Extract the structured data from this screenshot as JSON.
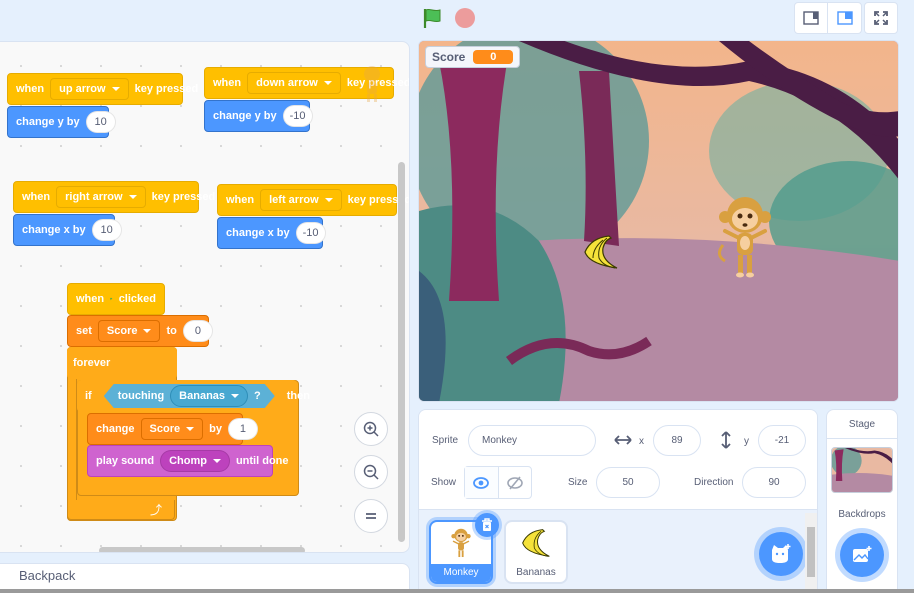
{
  "toolbar": {
    "green_flag_icon": "green-flag-icon",
    "stop_icon": "stop-icon",
    "small_stage_icon": "small-stage-icon",
    "normal_stage_icon": "normal-stage-icon",
    "fullscreen_icon": "fullscreen-icon"
  },
  "scripts": {
    "up": {
      "when": "when",
      "key": "up arrow",
      "pressed": "key pressed",
      "action": "change y by",
      "value": "10"
    },
    "down": {
      "when": "when",
      "key": "down arrow",
      "pressed": "key pressed",
      "action": "change y by",
      "value": "-10"
    },
    "right": {
      "when": "when",
      "key": "right arrow",
      "pressed": "key pressed",
      "action": "change x by",
      "value": "10"
    },
    "left": {
      "when": "when",
      "key": "left arrow",
      "pressed": "key pressed",
      "action": "change x by",
      "value": "-10"
    },
    "main": {
      "when": "when",
      "clicked": "clicked",
      "set": "set",
      "set_var": "Score",
      "to": "to",
      "set_value": "0",
      "forever": "forever",
      "if": "if",
      "touching": "touching",
      "touching_target": "Bananas",
      "question": "?",
      "then": "then",
      "change": "change",
      "change_var": "Score",
      "by": "by",
      "change_value": "1",
      "play_sound": "play sound",
      "sound": "Chomp",
      "until_done": "until done"
    }
  },
  "backpack": {
    "label": "Backpack"
  },
  "stage": {
    "monitor": {
      "label": "Score",
      "value": "0"
    }
  },
  "sprite_info": {
    "sprite_label": "Sprite",
    "sprite_name": "Monkey",
    "x_label": "x",
    "x_value": "89",
    "y_label": "y",
    "y_value": "-21",
    "show_label": "Show",
    "size_label": "Size",
    "size_value": "50",
    "direction_label": "Direction",
    "direction_value": "90"
  },
  "sprites": [
    {
      "name": "Monkey",
      "selected": true
    },
    {
      "name": "Bananas",
      "selected": false
    }
  ],
  "stage_pane": {
    "title": "Stage",
    "backdrops_label": "Backdrops"
  },
  "colors": {
    "events": "#ffbf00",
    "motion": "#4c97ff",
    "variables": "#ff8c1a",
    "control": "#ffab19",
    "sound": "#cf63cf",
    "sensing": "#5cb1d6",
    "accent": "#4c97ff"
  }
}
